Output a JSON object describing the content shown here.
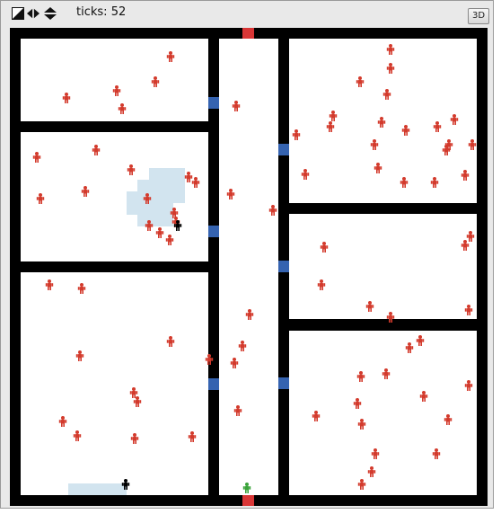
{
  "toolbar": {
    "ticks_label": "ticks:",
    "ticks_value": "52",
    "view_3d_label": "3D",
    "icons": [
      "speed-slider-icon",
      "step-arrows-icon",
      "speed-arrows-icon"
    ]
  },
  "colors": {
    "wall": "#000000",
    "floor": "#ffffff",
    "door": "#3563b0",
    "exit": "#d93636",
    "person": "#d33a2c",
    "evacuee_black": "#000000",
    "evacuee_green": "#3aa33a",
    "smoke": "#d2e4ef"
  }
}
